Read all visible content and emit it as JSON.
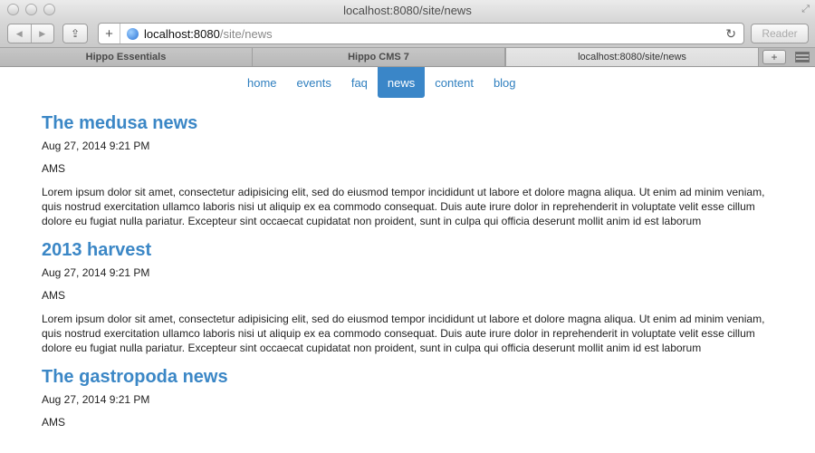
{
  "window": {
    "title": "localhost:8080/site/news"
  },
  "toolbar": {
    "back_icon": "back-arrow-icon",
    "forward_icon": "forward-arrow-icon",
    "share_icon": "share-icon",
    "add_icon": "plus-icon",
    "url_host": "localhost:8080",
    "url_path": "/site/news",
    "reload_icon": "reload-icon",
    "reader_label": "Reader"
  },
  "tabs": [
    {
      "label": "Hippo Essentials",
      "active": false
    },
    {
      "label": "Hippo CMS 7",
      "active": false
    },
    {
      "label": "localhost:8080/site/news",
      "active": true
    }
  ],
  "nav": {
    "items": [
      {
        "label": "home",
        "active": false
      },
      {
        "label": "events",
        "active": false
      },
      {
        "label": "faq",
        "active": false
      },
      {
        "label": "news",
        "active": true
      },
      {
        "label": "content",
        "active": false
      },
      {
        "label": "blog",
        "active": false
      }
    ]
  },
  "articles": [
    {
      "title": "The medusa news",
      "date": "Aug 27, 2014 9:21 PM",
      "author": "AMS",
      "body": "Lorem ipsum dolor sit amet, consectetur adipisicing elit, sed do eiusmod tempor incididunt ut labore et dolore magna aliqua. Ut enim ad minim veniam, quis nostrud exercitation ullamco laboris nisi ut aliquip ex ea commodo consequat. Duis aute irure dolor in reprehenderit in voluptate velit esse cillum dolore eu fugiat nulla pariatur. Excepteur sint occaecat cupidatat non proident, sunt in culpa qui officia deserunt mollit anim id est laborum"
    },
    {
      "title": "2013 harvest",
      "date": "Aug 27, 2014 9:21 PM",
      "author": "AMS",
      "body": "Lorem ipsum dolor sit amet, consectetur adipisicing elit, sed do eiusmod tempor incididunt ut labore et dolore magna aliqua. Ut enim ad minim veniam, quis nostrud exercitation ullamco laboris nisi ut aliquip ex ea commodo consequat. Duis aute irure dolor in reprehenderit in voluptate velit esse cillum dolore eu fugiat nulla pariatur. Excepteur sint occaecat cupidatat non proident, sunt in culpa qui officia deserunt mollit anim id est laborum"
    },
    {
      "title": "The gastropoda news",
      "date": "Aug 27, 2014 9:21 PM",
      "author": "AMS",
      "body": ""
    }
  ],
  "colors": {
    "link": "#2f7fbf",
    "heading": "#3b87c6",
    "nav_active_bg": "#3a86c8"
  }
}
